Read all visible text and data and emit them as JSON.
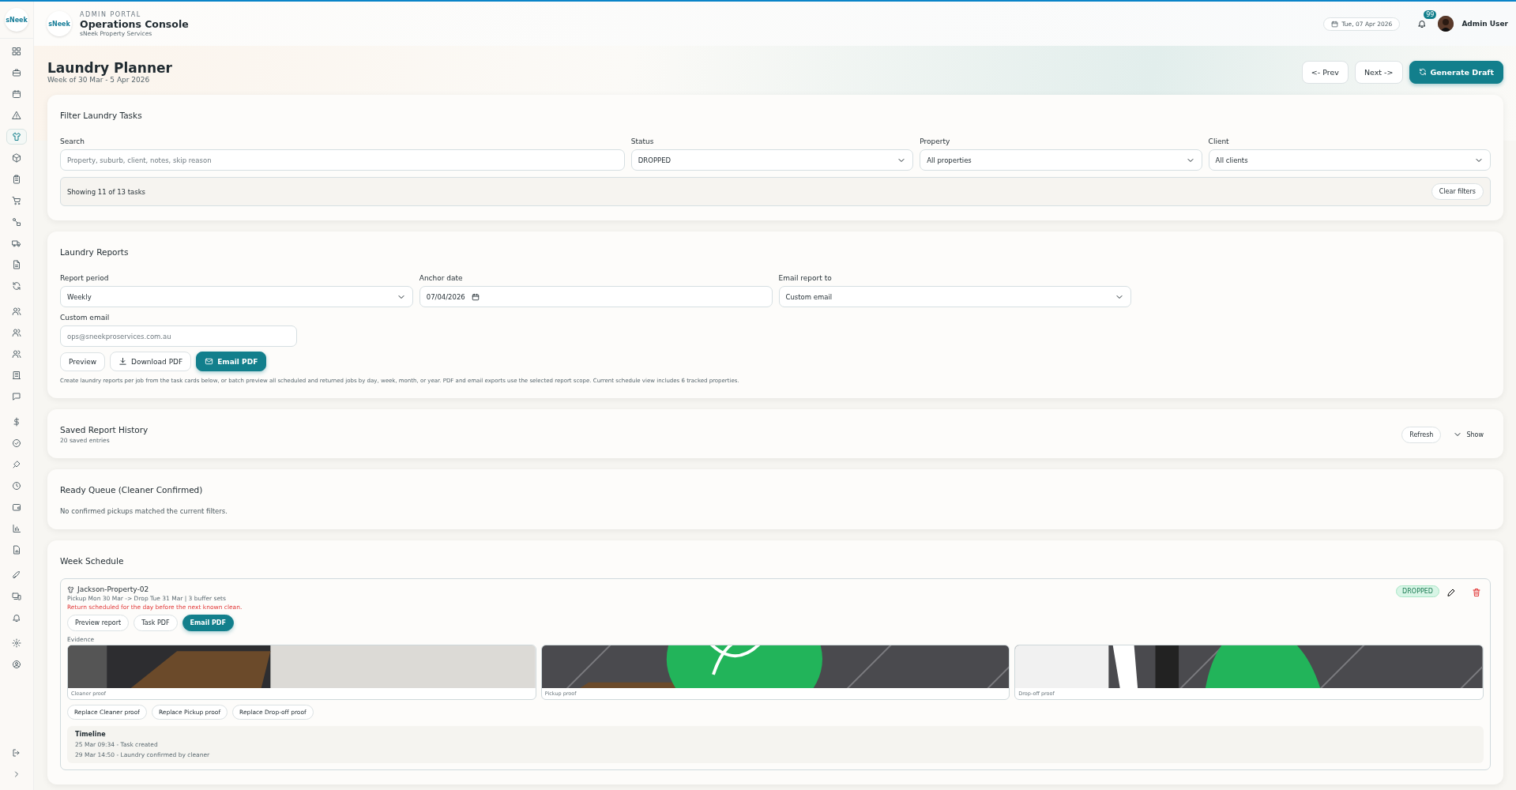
{
  "header": {
    "logo": "sNeek",
    "eyebrow": "ADMIN PORTAL",
    "title": "Operations Console",
    "subtitle": "sNeek Property Services",
    "date": "Tue, 07 Apr 2026",
    "notification_count": "99",
    "user": "Admin User"
  },
  "sidebar": {
    "logo": "sNeek",
    "groups": [
      [
        {
          "selected": false
        },
        {
          "selected": false
        },
        {
          "selected": false
        },
        {
          "selected": false
        },
        {
          "selected": true
        },
        {
          "selected": false
        },
        {
          "selected": false
        },
        {
          "selected": false
        },
        {
          "selected": false
        },
        {
          "selected": false
        },
        {
          "selected": false
        },
        {
          "selected": false
        }
      ],
      [
        {
          "selected": false
        },
        {
          "selected": false
        },
        {
          "selected": false
        },
        {
          "selected": false
        },
        {
          "selected": false
        }
      ],
      [
        {
          "selected": false
        },
        {
          "selected": false
        },
        {
          "selected": false
        },
        {
          "selected": false
        },
        {
          "selected": false
        },
        {
          "selected": false
        },
        {
          "selected": false
        }
      ],
      [
        {
          "selected": false
        },
        {
          "selected": false
        },
        {
          "selected": false
        }
      ],
      [
        {
          "selected": false
        },
        {
          "selected": false
        }
      ]
    ]
  },
  "page": {
    "title": "Laundry Planner",
    "subtitle": "Week of 30 Mar - 5 Apr 2026",
    "buttons": [
      {
        "label": "<- Prev",
        "kind": "plain"
      },
      {
        "label": "Next ->",
        "kind": "plain"
      },
      {
        "label": "Generate Draft",
        "kind": "primary"
      }
    ]
  },
  "filter": {
    "title": "Filter Laundry Tasks",
    "fields": [
      {
        "label": "Search",
        "kind": "text",
        "placeholder": "Property, suburb, client, notes, skip reason"
      },
      {
        "label": "Status",
        "kind": "select",
        "value": "DROPPED"
      },
      {
        "label": "Property",
        "kind": "select",
        "value": "All properties"
      },
      {
        "label": "Client",
        "kind": "select",
        "value": "All clients"
      }
    ],
    "summary": "Showing 11 of 13 tasks",
    "clear_button": "Clear filters"
  },
  "reports": {
    "title": "Laundry Reports",
    "fields": [
      {
        "label": "Report period",
        "kind": "select",
        "value": "Weekly"
      },
      {
        "label": "Anchor date",
        "kind": "date",
        "value": "07/04/2026"
      },
      {
        "label": "Email report to",
        "kind": "select",
        "value": "Custom email"
      }
    ],
    "custom_email": {
      "label": "Custom email",
      "placeholder": "ops@sneekproservices.com.au"
    },
    "buttons": [
      {
        "label": "Preview",
        "kind": "plain"
      },
      {
        "label": "Download PDF",
        "kind": "download"
      },
      {
        "label": "Email PDF",
        "kind": "email"
      }
    ],
    "note": "Create laundry reports per job from the task cards below, or batch preview all scheduled and returned jobs by day, week, month, or year. PDF and email exports use the selected report scope. Current schedule view includes 6 tracked properties."
  },
  "history": {
    "title": "Saved Report History",
    "subtitle": "20 saved entries",
    "refresh_button": "Refresh",
    "toggle": "Show"
  },
  "ready_queue": {
    "title": "Ready Queue (Cleaner Confirmed)",
    "message": "No confirmed pickups matched the current filters."
  },
  "schedule": {
    "title": "Week Schedule",
    "task": {
      "name": "Jackson-Property-02",
      "details": "Pickup Mon 30 Mar -> Drop Tue 31 Mar | 3 buffer sets",
      "warning": "Return scheduled for the day before the next known clean.",
      "status": "DROPPED",
      "actions": [
        {
          "label": "Preview report",
          "kind": "plain"
        },
        {
          "label": "Task PDF",
          "kind": "plain"
        },
        {
          "label": "Email PDF",
          "kind": "primary"
        }
      ],
      "evidence_label": "Evidence",
      "evidence": [
        {
          "caption": "Cleaner proof"
        },
        {
          "caption": "Pickup proof"
        },
        {
          "caption": "Drop-off proof"
        }
      ],
      "replace_buttons": [
        "Replace Cleaner proof",
        "Replace Pickup proof",
        "Replace Drop-off proof"
      ],
      "timeline": {
        "title": "Timeline",
        "entries": [
          "25 Mar 09:34 - Task created",
          "29 Mar 14:50 - Laundry confirmed by cleaner"
        ]
      }
    }
  }
}
